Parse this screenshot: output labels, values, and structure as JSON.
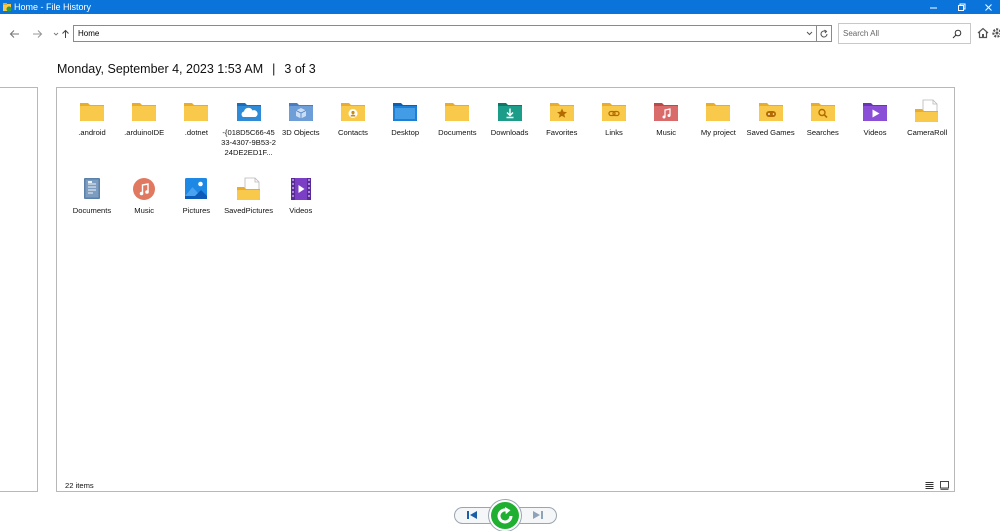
{
  "window": {
    "title": "Home - File History"
  },
  "nav": {
    "address": "Home",
    "search_placeholder": "Search All"
  },
  "header": {
    "date": "Monday, September 4, 2023 1:53 AM",
    "separator": "|",
    "position": "3 of 3"
  },
  "items": [
    {
      "label": ".android",
      "icon": "folder-icon"
    },
    {
      "label": ".arduinoIDE",
      "icon": "folder-icon"
    },
    {
      "label": ".dotnet",
      "icon": "folder-icon"
    },
    {
      "label": "-{018D5C66-4533-4307-9B53-224DE2ED1F...",
      "icon": "onedrive-folder-icon"
    },
    {
      "label": "3D Objects",
      "icon": "3d-objects-folder-icon"
    },
    {
      "label": "Contacts",
      "icon": "contacts-folder-icon"
    },
    {
      "label": "Desktop",
      "icon": "desktop-folder-icon"
    },
    {
      "label": "Documents",
      "icon": "folder-icon"
    },
    {
      "label": "Downloads",
      "icon": "downloads-folder-icon"
    },
    {
      "label": "Favorites",
      "icon": "favorites-folder-icon"
    },
    {
      "label": "Links",
      "icon": "links-folder-icon"
    },
    {
      "label": "Music",
      "icon": "music-folder-icon"
    },
    {
      "label": "My project",
      "icon": "folder-icon"
    },
    {
      "label": "Saved Games",
      "icon": "saved-games-folder-icon"
    },
    {
      "label": "Searches",
      "icon": "searches-folder-icon"
    },
    {
      "label": "Videos",
      "icon": "videos-folder-icon"
    },
    {
      "label": "CameraRoll",
      "icon": "camera-roll-folder-icon"
    },
    {
      "label": "Documents",
      "icon": "documents-library-icon"
    },
    {
      "label": "Music",
      "icon": "music-library-icon"
    },
    {
      "label": "Pictures",
      "icon": "pictures-library-icon"
    },
    {
      "label": "SavedPictures",
      "icon": "saved-pictures-folder-icon"
    },
    {
      "label": "Videos",
      "icon": "videos-library-icon"
    }
  ],
  "status": {
    "count": "22 items"
  },
  "colors": {
    "titlebar": "#0a74da",
    "folder": "#f8c94a",
    "restore_button": "#1fb032"
  }
}
